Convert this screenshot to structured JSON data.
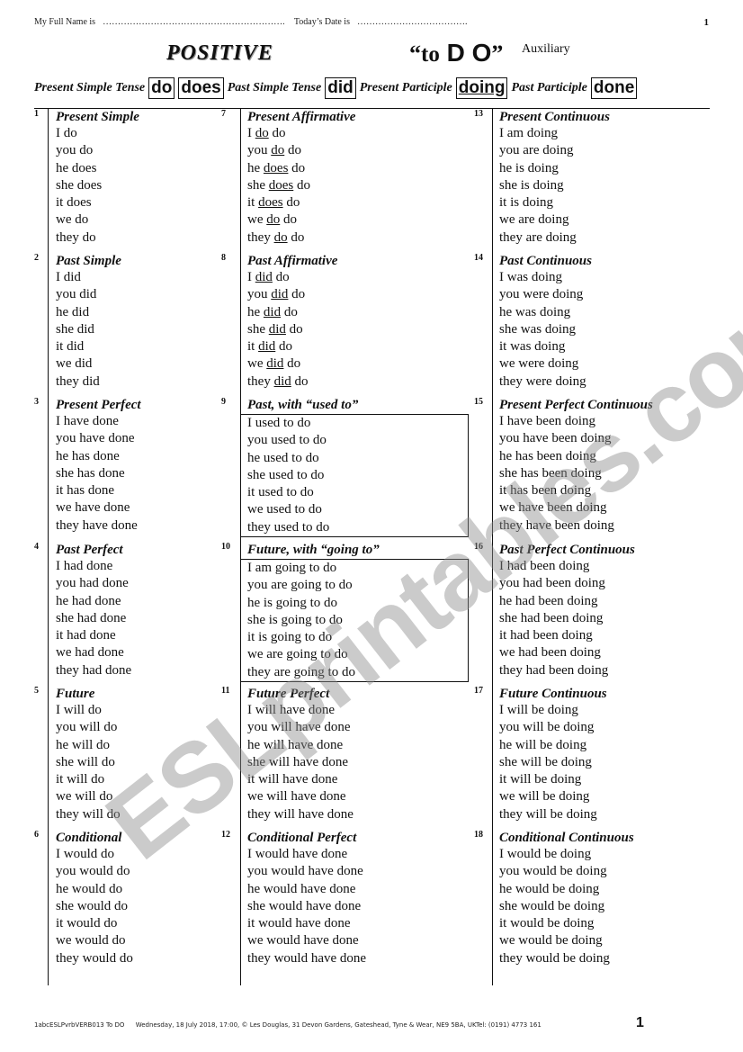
{
  "header": {
    "name_label": "My Full Name is",
    "name_dots": "…………………………………………………….",
    "date_label": "Today’s Date is",
    "date_dots": "……………………………….",
    "page_number": "1"
  },
  "title": {
    "polarity": "POSITIVE",
    "verb_open_quote": "“",
    "verb_to": "to",
    "verb_main": "D O",
    "verb_close_quote": "”",
    "verb_type": "Auxiliary"
  },
  "forms": {
    "present_simple_label": "Present Simple Tense",
    "present_simple_1": "do",
    "present_simple_2": "does",
    "past_simple_label": "Past Simple Tense",
    "past_simple": "did",
    "present_participle_label": "Present Participle",
    "present_participle": "doing",
    "past_participle_label": "Past Participle",
    "past_participle": "done"
  },
  "columns": [
    {
      "cells": [
        {
          "num": "1",
          "title": "Present Simple",
          "lines": [
            "I do",
            "you do",
            "he does",
            "she does",
            "it does",
            "we do",
            "they do"
          ]
        },
        {
          "num": "2",
          "title": "Past Simple",
          "lines": [
            "I did",
            "you did",
            "he did",
            "she did",
            "it did",
            "we did",
            "they did"
          ]
        },
        {
          "num": "3",
          "title": "Present Perfect",
          "lines": [
            "I have done",
            "you have done",
            "he has done",
            "she has done",
            "it has done",
            "we have done",
            "they have done"
          ]
        },
        {
          "num": "4",
          "title": "Past Perfect",
          "lines": [
            "I had done",
            "you had done",
            "he had done",
            "she had done",
            "it had done",
            "we had done",
            "they had done"
          ]
        },
        {
          "num": "5",
          "title": "Future",
          "lines": [
            "I will do",
            "you will do",
            "he will do",
            "she will do",
            "it will do",
            "we will do",
            "they will do"
          ]
        },
        {
          "num": "6",
          "title": "Conditional",
          "lines": [
            "I would do",
            "you would do",
            "he would do",
            "she would do",
            "it would do",
            "we would do",
            "they would do"
          ]
        }
      ]
    },
    {
      "cells": [
        {
          "num": "7",
          "title": "Present Affirmative",
          "emphatic": true,
          "lines": [
            [
              "I ",
              "do",
              " do"
            ],
            [
              "you ",
              "do",
              " do"
            ],
            [
              "he ",
              "does",
              " do"
            ],
            [
              "she ",
              "does",
              " do"
            ],
            [
              "it ",
              "does",
              " do"
            ],
            [
              "we ",
              "do",
              " do"
            ],
            [
              "they ",
              "do",
              " do"
            ]
          ]
        },
        {
          "num": "8",
          "title": "Past Affirmative",
          "emphatic": true,
          "lines": [
            [
              "I ",
              "did",
              " do"
            ],
            [
              "you ",
              "did",
              " do"
            ],
            [
              "he ",
              "did",
              " do"
            ],
            [
              "she ",
              "did",
              " do"
            ],
            [
              "it ",
              "did",
              " do"
            ],
            [
              "we ",
              "did",
              " do"
            ],
            [
              "they ",
              "did",
              " do"
            ]
          ]
        },
        {
          "num": "9",
          "title": "Past, with “used to”",
          "boxed": true,
          "lines": [
            "I used to do",
            "you used to do",
            "he used to do",
            "she used to do",
            "it used to do",
            "we used to do",
            "they used to do"
          ]
        },
        {
          "num": "10",
          "title": "Future, with “going to”",
          "boxed": true,
          "lines": [
            "I am going to do",
            "you are going to do",
            "he is going to do",
            "she is going to do",
            "it is going to do",
            "we are going to do",
            "they are going to do"
          ]
        },
        {
          "num": "11",
          "title": "Future Perfect",
          "lines": [
            "I will have done",
            "you will have done",
            "he will have done",
            "she will have done",
            "it will have done",
            "we will have done",
            "they will have done"
          ]
        },
        {
          "num": "12",
          "title": "Conditional Perfect",
          "lines": [
            "I would have done",
            "you would have done",
            "he would have done",
            "she would have done",
            "it would have done",
            "we would have done",
            "they would have done"
          ]
        }
      ]
    },
    {
      "cells": [
        {
          "num": "13",
          "title": "Present Continuous",
          "lines": [
            "I am doing",
            "you are doing",
            "he is doing",
            "she is doing",
            "it is doing",
            "we are doing",
            "they are doing"
          ]
        },
        {
          "num": "14",
          "title": "Past Continuous",
          "lines": [
            "I was doing",
            "you were doing",
            "he was doing",
            "she was doing",
            "it was doing",
            "we were doing",
            "they were doing"
          ]
        },
        {
          "num": "15",
          "title": "Present Perfect Continuous",
          "lines": [
            "I have been doing",
            "you have been doing",
            "he has been doing",
            "she has been doing",
            "it has been doing",
            "we have been doing",
            "they have been doing"
          ]
        },
        {
          "num": "16",
          "title": "Past Perfect Continuous",
          "lines": [
            "I had been doing",
            "you had been doing",
            "he had been doing",
            "she had been doing",
            "it had been doing",
            "we had been doing",
            "they had been doing"
          ]
        },
        {
          "num": "17",
          "title": "Future Continuous",
          "lines": [
            "I will be doing",
            "you will be doing",
            "he will be doing",
            "she will be doing",
            "it will be doing",
            "we will be doing",
            "they will be doing"
          ]
        },
        {
          "num": "18",
          "title": "Conditional Continuous",
          "lines": [
            "I would be doing",
            "you would be doing",
            "he would be doing",
            "she would be doing",
            "it would be doing",
            "we would be doing",
            "they would be doing"
          ]
        }
      ]
    }
  ],
  "footer": {
    "file": "1abcESLPvrbVERB013 To DO",
    "info": "Wednesday, 18 July 2018, 17:00, © Les Douglas, 31 Devon Gardens, Gateshead, Tyne & Wear, NE9 5BA, UKTel: (0191) 4773 161",
    "page_number": "1"
  },
  "watermark": "ESLprintables.com"
}
